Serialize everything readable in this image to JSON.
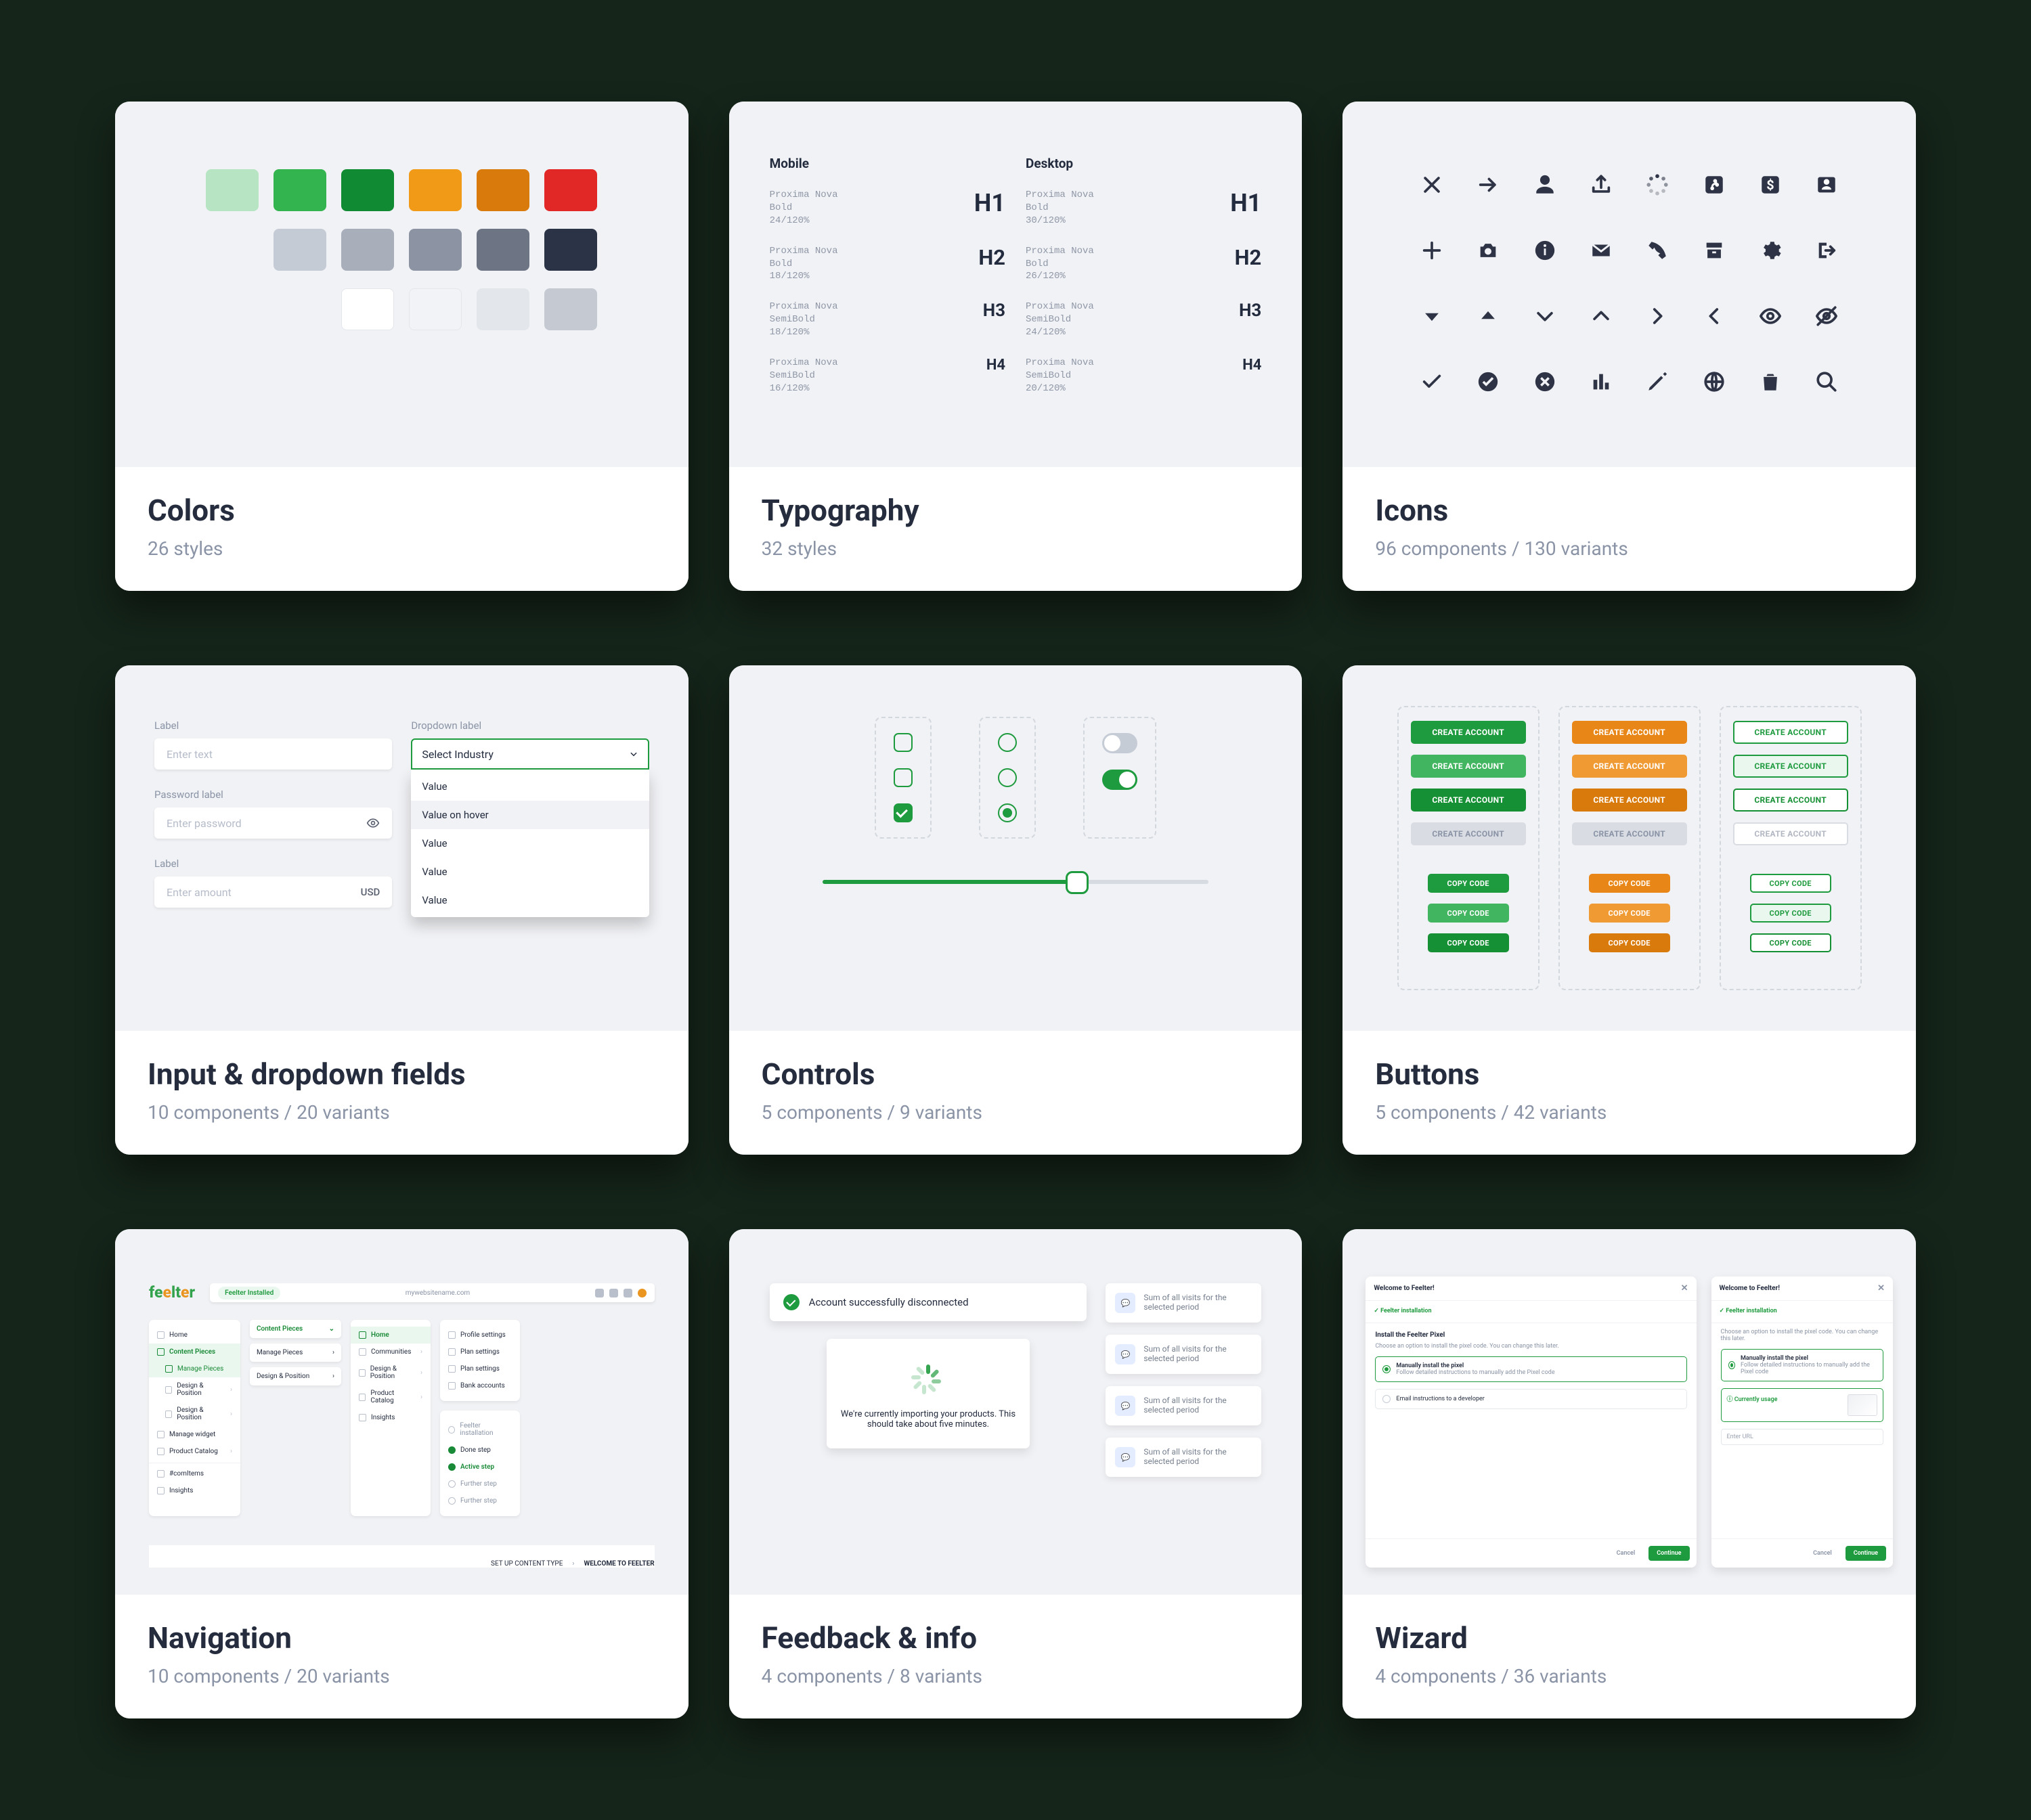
{
  "cards": {
    "colors": {
      "title": "Colors",
      "sub": "26 styles"
    },
    "typography": {
      "title": "Typography",
      "sub": "32 styles"
    },
    "icons": {
      "title": "Icons",
      "sub": "96 components / 130 variants"
    },
    "inputs": {
      "title": "Input & dropdown fields",
      "sub": "10 components / 20 variants"
    },
    "controls": {
      "title": "Controls",
      "sub": "5 components / 9 variants"
    },
    "buttons": {
      "title": "Buttons",
      "sub": "5 components / 42 variants"
    },
    "navigation": {
      "title": "Navigation",
      "sub": "10 components / 20 variants"
    },
    "feedback": {
      "title": "Feedback & info",
      "sub": "4 components / 8 variants"
    },
    "wizard": {
      "title": "Wizard",
      "sub": "4 components / 36 variants"
    }
  },
  "swatches": {
    "row1": [
      "#b7e4c2",
      "#33b44f",
      "#118b33",
      "#f09a17",
      "#d97a0d",
      "#e22727"
    ],
    "row2": [
      "#c5cbd5",
      "#a8afbb",
      "#8c94a3",
      "#6d7585",
      "#2b3347"
    ],
    "row3": [
      "#ffffff",
      "#f1f3f6",
      "#e3e6eb",
      "#c4c9d2"
    ]
  },
  "typography": {
    "mobile_label": "Mobile",
    "desktop_label": "Desktop",
    "mobile": [
      {
        "meta": "Proxima Nova\nBold\n24/120%",
        "h": "H1"
      },
      {
        "meta": "Proxima Nova\nBold\n18/120%",
        "h": "H2"
      },
      {
        "meta": "Proxima Nova\nSemiBold\n18/120%",
        "h": "H3"
      },
      {
        "meta": "Proxima Nova\nSemiBold\n16/120%",
        "h": "H4"
      }
    ],
    "desktop": [
      {
        "meta": "Proxima Nova\nBold\n30/120%",
        "h": "H1"
      },
      {
        "meta": "Proxima Nova\nBold\n26/120%",
        "h": "H2"
      },
      {
        "meta": "Proxima Nova\nSemiBold\n24/120%",
        "h": "H3"
      },
      {
        "meta": "Proxima Nova\nSemiBold\n20/120%",
        "h": "H4"
      }
    ]
  },
  "inputs": {
    "label1": "Label",
    "placeholder1": "Enter text",
    "label2": "Password label",
    "placeholder2": "Enter password",
    "label3": "Label",
    "placeholder3": "Enter amount",
    "suffix": "USD",
    "dd_label": "Dropdown label",
    "dd_selected": "Select Industry",
    "dd_items": [
      "Value",
      "Value on hover",
      "Value",
      "Value",
      "Value"
    ]
  },
  "buttons": {
    "primary": "CREATE ACCOUNT",
    "secondary": "Copy code"
  },
  "navigation": {
    "logo": "feelter",
    "topbar_badge": "Feelter Installed",
    "topbar_url": "mywebsitename.com",
    "menu1": [
      "Home",
      "Content Pieces",
      "Manage Pieces",
      "Design & Position",
      "Design & Position",
      "Manage widget",
      "Product Catalog",
      "#comItems",
      "Insights"
    ],
    "menu2": [
      "Home",
      "Communities",
      "Design & Position",
      "Product Catalog",
      "Insights"
    ],
    "menu3": [
      "Profile settings",
      "Plan settings",
      "Plan settings",
      "Bank accounts"
    ],
    "menu4": [
      "Feelter installation",
      "Done step",
      "Active step",
      "Further step",
      "Further step"
    ],
    "accordion": [
      "Content Pieces",
      "Manage Pieces",
      "Design & Position"
    ],
    "crumb1": "SET UP CONTENT TYPE",
    "crumb2": "WELCOME TO FEELTER"
  },
  "feedback": {
    "alert": "Account successfully disconnected",
    "spinner_text": "We're currently importing your products. This should take about five minutes.",
    "callout": "Sum of all visits for the selected period"
  },
  "wizard": {
    "title": "Welcome to Feelter!",
    "summary_done": "Feelter installation",
    "step_title": "Install the Feelter Pixel",
    "step_sub": "Choose an option to install the pixel code. You can change this later.",
    "opt1": "Manually install the pixel",
    "opt1_sub": "Follow detailed instructions to manually add the Pixel code",
    "opt2": "Email instructions to a developer",
    "btn_cancel": "Cancel",
    "btn_next": "Continue",
    "right_sub": "Choose an option to install the pixel code. You can change this later.",
    "right_opt_title": "Manually install the pixel",
    "right_opt_sub": "Follow detailed instructions to manually add the Pixel code",
    "right_banner_title": "Currently usage",
    "placeholder": "Enter URL"
  }
}
